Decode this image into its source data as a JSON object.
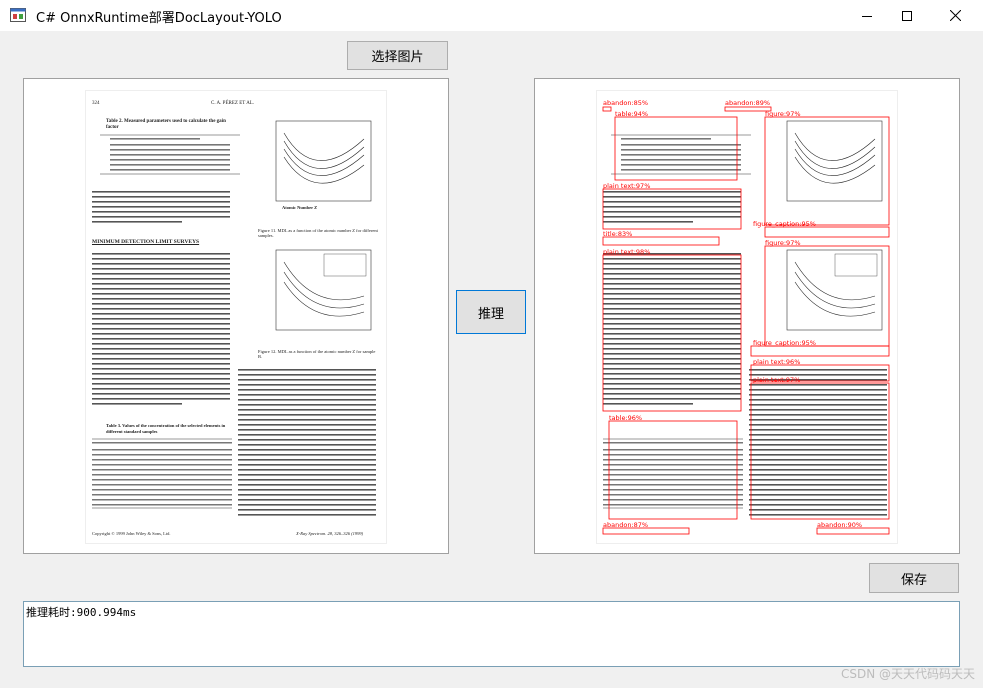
{
  "window": {
    "title": "C# OnnxRuntime部署DocLayout-YOLO",
    "minimize_icon": "minimize-icon",
    "maximize_icon": "maximize-icon",
    "close_icon": "close-icon"
  },
  "toolbar": {
    "select_image_label": "选择图片",
    "infer_label": "推理",
    "save_label": "保存"
  },
  "document": {
    "page_number": "324",
    "running_head": "C. A. PÉREZ ET AL.",
    "table2_title": "Table 2. Measured parameters used to calculate the gain factor",
    "section_heading": "MINIMUM DETECTION LIMIT SURVEYS",
    "fig11_caption": "Figure 11. MDL as a function of the atomic number Z for different samples.",
    "fig12_caption": "Figure 12. MDL as a function of the atomic number Z for sample B.",
    "table3_title": "Table 3. Values of the concentration of the selected elements in different standard samples",
    "footer_left": "Copyright © 1999 John Wiley & Sons, Ltd.",
    "footer_right": "X-Ray Spectrom. 28, 326–326 (1999)",
    "x_axis_label": "Atomic Number Z"
  },
  "detections": [
    {
      "label": "abandon:85%"
    },
    {
      "label": "abandon:89%"
    },
    {
      "label": "table:94%"
    },
    {
      "label": "figure:97%"
    },
    {
      "label": "plain text:97%"
    },
    {
      "label": "figure_caption:95%"
    },
    {
      "label": "title:83%"
    },
    {
      "label": "figure:97%"
    },
    {
      "label": "plain text:98%"
    },
    {
      "label": "figure_caption:95%"
    },
    {
      "label": "plain text:96%"
    },
    {
      "label": "plain text:97%"
    },
    {
      "label": "table:96%"
    },
    {
      "label": "abandon:87%"
    },
    {
      "label": "abandon:90%"
    }
  ],
  "status": {
    "text": "推理耗时:900.994ms"
  },
  "watermark": "CSDN @天天代码码天天",
  "colors": {
    "detection_box": "#ff0000",
    "window_bg": "#f0f0f0"
  }
}
